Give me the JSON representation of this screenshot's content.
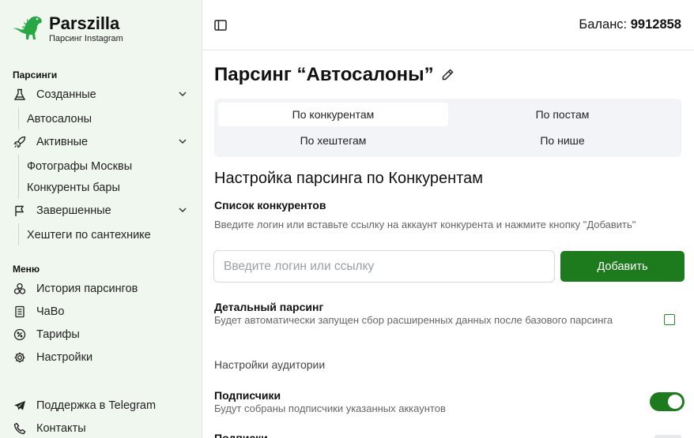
{
  "brand": {
    "name": "Parszilla",
    "subtitle": "Парсинг Instagram"
  },
  "sidebar": {
    "parsings_title": "Парсинги",
    "groups": [
      {
        "label": "Созданные",
        "icon": "flask-icon",
        "items": [
          "Автосалоны"
        ]
      },
      {
        "label": "Активные",
        "icon": "rocket-icon",
        "items": [
          "Фотографы Москвы",
          "Конкуренты бары"
        ]
      },
      {
        "label": "Завершенные",
        "icon": "flag-icon",
        "items": [
          "Хештеги по сантехнике"
        ]
      }
    ],
    "menu_title": "Меню",
    "menu": [
      {
        "label": "История парсингов",
        "icon": "history-icon"
      },
      {
        "label": "ЧаВо",
        "icon": "book-icon"
      },
      {
        "label": "Тарифы",
        "icon": "percent-icon"
      },
      {
        "label": "Настройки",
        "icon": "gear-icon"
      }
    ],
    "footer": [
      {
        "label": "Поддержка в Telegram",
        "icon": "telegram-icon"
      },
      {
        "label": "Контакты",
        "icon": "phone-icon"
      }
    ]
  },
  "header": {
    "balance_label": "Баланс:",
    "balance_value": "9912858"
  },
  "page": {
    "title": "Парсинг “Автосалоны”",
    "tabs": [
      "По конкурентам",
      "По постам",
      "По хештегам",
      "По нише"
    ],
    "active_tab": "По конкурентам",
    "section_title": "Настройка парсинга по Конкурентам",
    "competitors": {
      "label": "Список конкурентов",
      "help": "Введите логин или вставьте ссылку на аккаунт конкурента и нажмите кнопку \"Добавить\"",
      "placeholder": "Введите логин или ссылку",
      "value": "",
      "add_label": "Добавить"
    },
    "detailed": {
      "label": "Детальный парсинг",
      "help": "Будет автоматически запущен сбор расширенных данных после базового парсинга",
      "checked": false
    },
    "audience_title": "Настройки аудитории",
    "followers": {
      "label": "Подписчики",
      "help": "Будут собраны подписчики указанных аккаунтов",
      "enabled": true
    },
    "following": {
      "label": "Подписки"
    }
  },
  "colors": {
    "accent": "#1d7a1d",
    "sidebar_bg": "#f0f7ee"
  }
}
